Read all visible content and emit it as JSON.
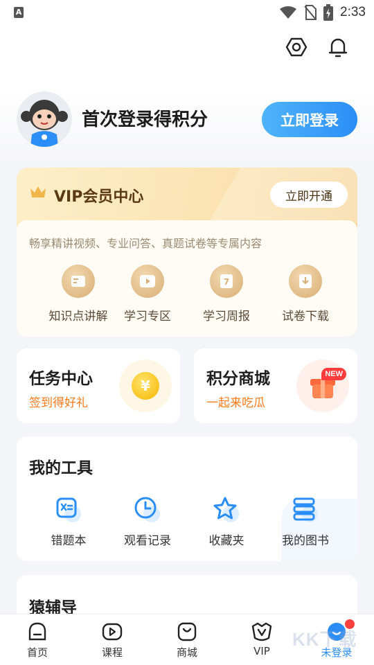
{
  "status_bar": {
    "left_icon_glyph": "A",
    "time": "2:33",
    "icons": [
      "wifi-icon",
      "no-sim-icon",
      "battery-charging-icon"
    ]
  },
  "header": {
    "icons": [
      "settings-hexagon-icon",
      "bell-icon"
    ]
  },
  "profile": {
    "title": "首次登录得积分",
    "login_button": "立即登录"
  },
  "vip": {
    "title": "VIP会员中心",
    "open_button": "立即开通",
    "description": "畅享精讲视频、专业问答、真题试卷等专属内容",
    "items": [
      {
        "label": "知识点讲解",
        "icon": "book-card-icon"
      },
      {
        "label": "学习专区",
        "icon": "play-icon"
      },
      {
        "label": "学习周报",
        "icon": "calendar-7-icon"
      },
      {
        "label": "试卷下载",
        "icon": "download-icon"
      }
    ]
  },
  "tasks": {
    "task_center": {
      "title": "任务中心",
      "subtitle": "签到得好礼",
      "coin_glyph": "¥"
    },
    "points_mall": {
      "title": "积分商城",
      "subtitle": "一起来吃瓜",
      "badge": "NEW"
    }
  },
  "tools": {
    "title": "我的工具",
    "items": [
      {
        "label": "错题本",
        "icon": "wrong-notebook-icon"
      },
      {
        "label": "观看记录",
        "icon": "clock-icon"
      },
      {
        "label": "收藏夹",
        "icon": "star-icon"
      },
      {
        "label": "我的图书",
        "icon": "books-icon"
      }
    ]
  },
  "tutoring": {
    "title": "猿辅导"
  },
  "bottom_nav": {
    "items": [
      {
        "label": "首页",
        "icon": "home-icon"
      },
      {
        "label": "课程",
        "icon": "course-play-icon"
      },
      {
        "label": "商城",
        "icon": "shop-bag-icon"
      },
      {
        "label": "VIP",
        "icon": "vip-icon"
      },
      {
        "label": "未登录",
        "icon": "profile-icon",
        "active": true
      }
    ]
  },
  "watermark": "KK下载",
  "colors": {
    "accent_blue": "#2b8ef6",
    "orange_text": "#ff7a1a",
    "vip_gold": "#fbe2b0",
    "badge_red": "#ff3b3b"
  }
}
